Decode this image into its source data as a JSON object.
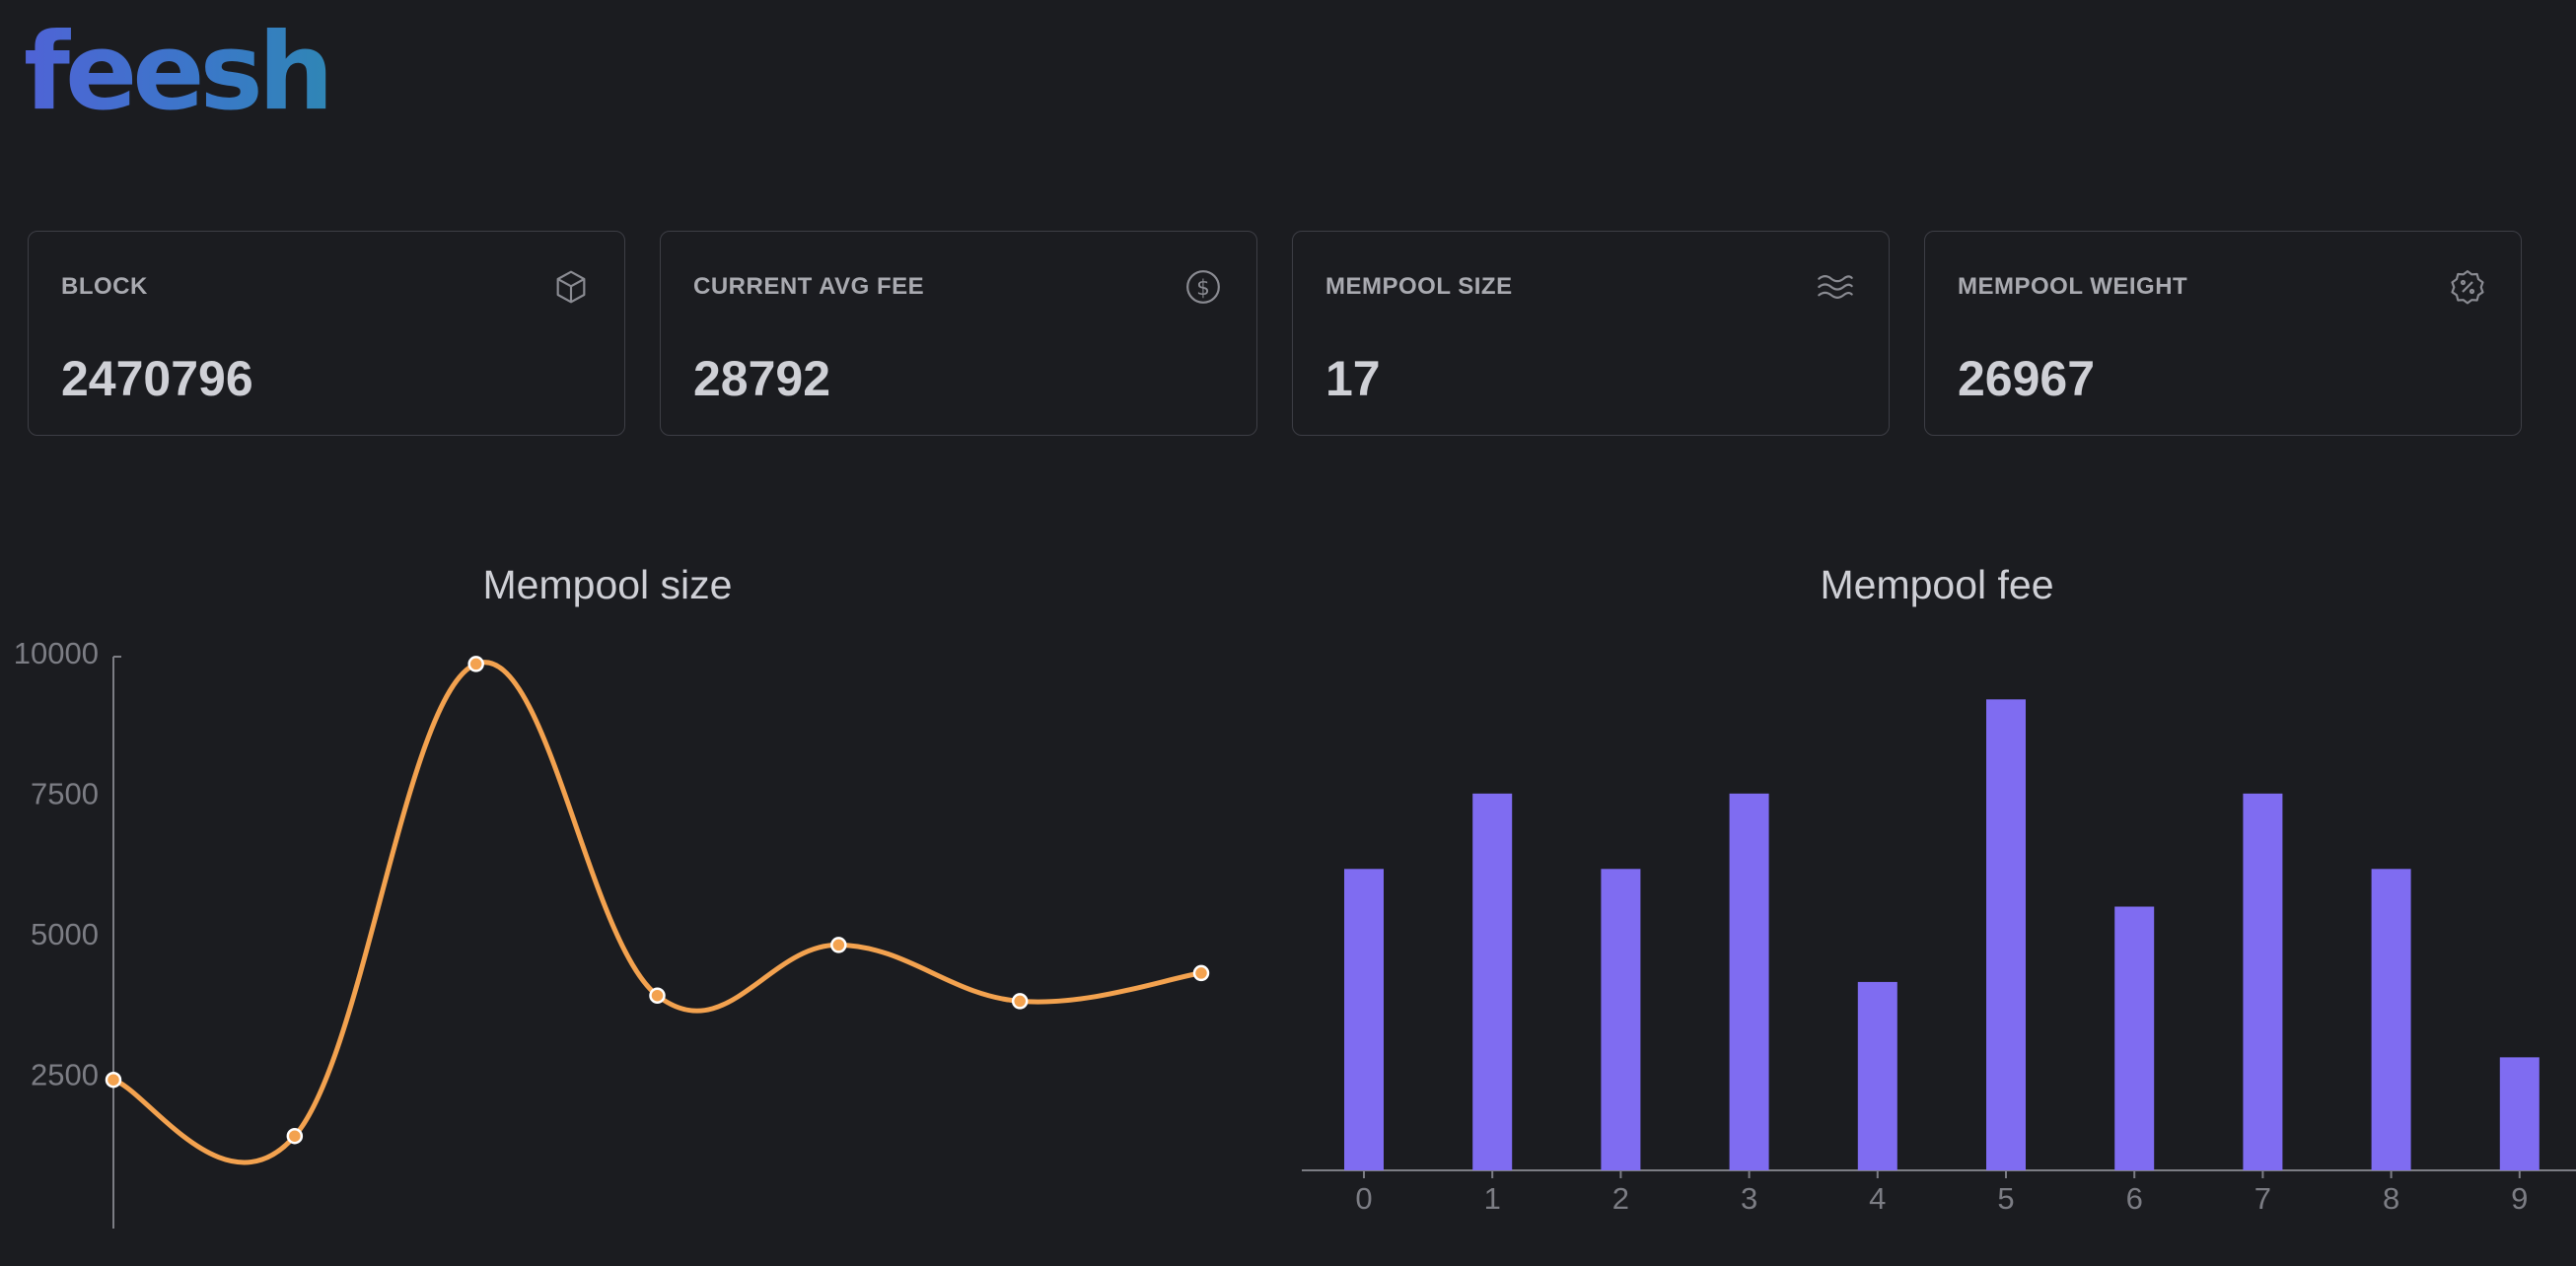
{
  "app": {
    "logo": "feesh"
  },
  "cards": [
    {
      "title": "BLOCK",
      "value": "2470796",
      "icon": "cube-icon"
    },
    {
      "title": "CURRENT AVG FEE",
      "value": "28792",
      "icon": "dollar-circle-icon"
    },
    {
      "title": "MEMPOOL SIZE",
      "value": "17",
      "icon": "waves-icon"
    },
    {
      "title": "MEMPOOL WEIGHT",
      "value": "26967",
      "icon": "percent-badge-icon"
    }
  ],
  "colors": {
    "line": "#f3a24f",
    "bar": "#7f6cf1",
    "logo_start": "#4f63d6",
    "logo_end": "#2f86b5"
  },
  "chart_data": [
    {
      "type": "line",
      "title": "Mempool size",
      "x": [
        0,
        1,
        2,
        3,
        4,
        5,
        6
      ],
      "values": [
        2400,
        1400,
        9800,
        3900,
        4800,
        3800,
        4300
      ],
      "ylim": [
        0,
        10000
      ],
      "yticks": [
        2500,
        5000,
        7500,
        10000
      ],
      "smooth": true,
      "grid": false
    },
    {
      "type": "bar",
      "title": "Mempool fee",
      "categories": [
        "0",
        "1",
        "2",
        "3",
        "4",
        "5",
        "6",
        "7",
        "8",
        "9"
      ],
      "values": [
        4000,
        5000,
        4000,
        5000,
        2500,
        6250,
        3500,
        5000,
        4000,
        1500
      ],
      "ylim": [
        0,
        7000
      ],
      "grid": false
    }
  ]
}
